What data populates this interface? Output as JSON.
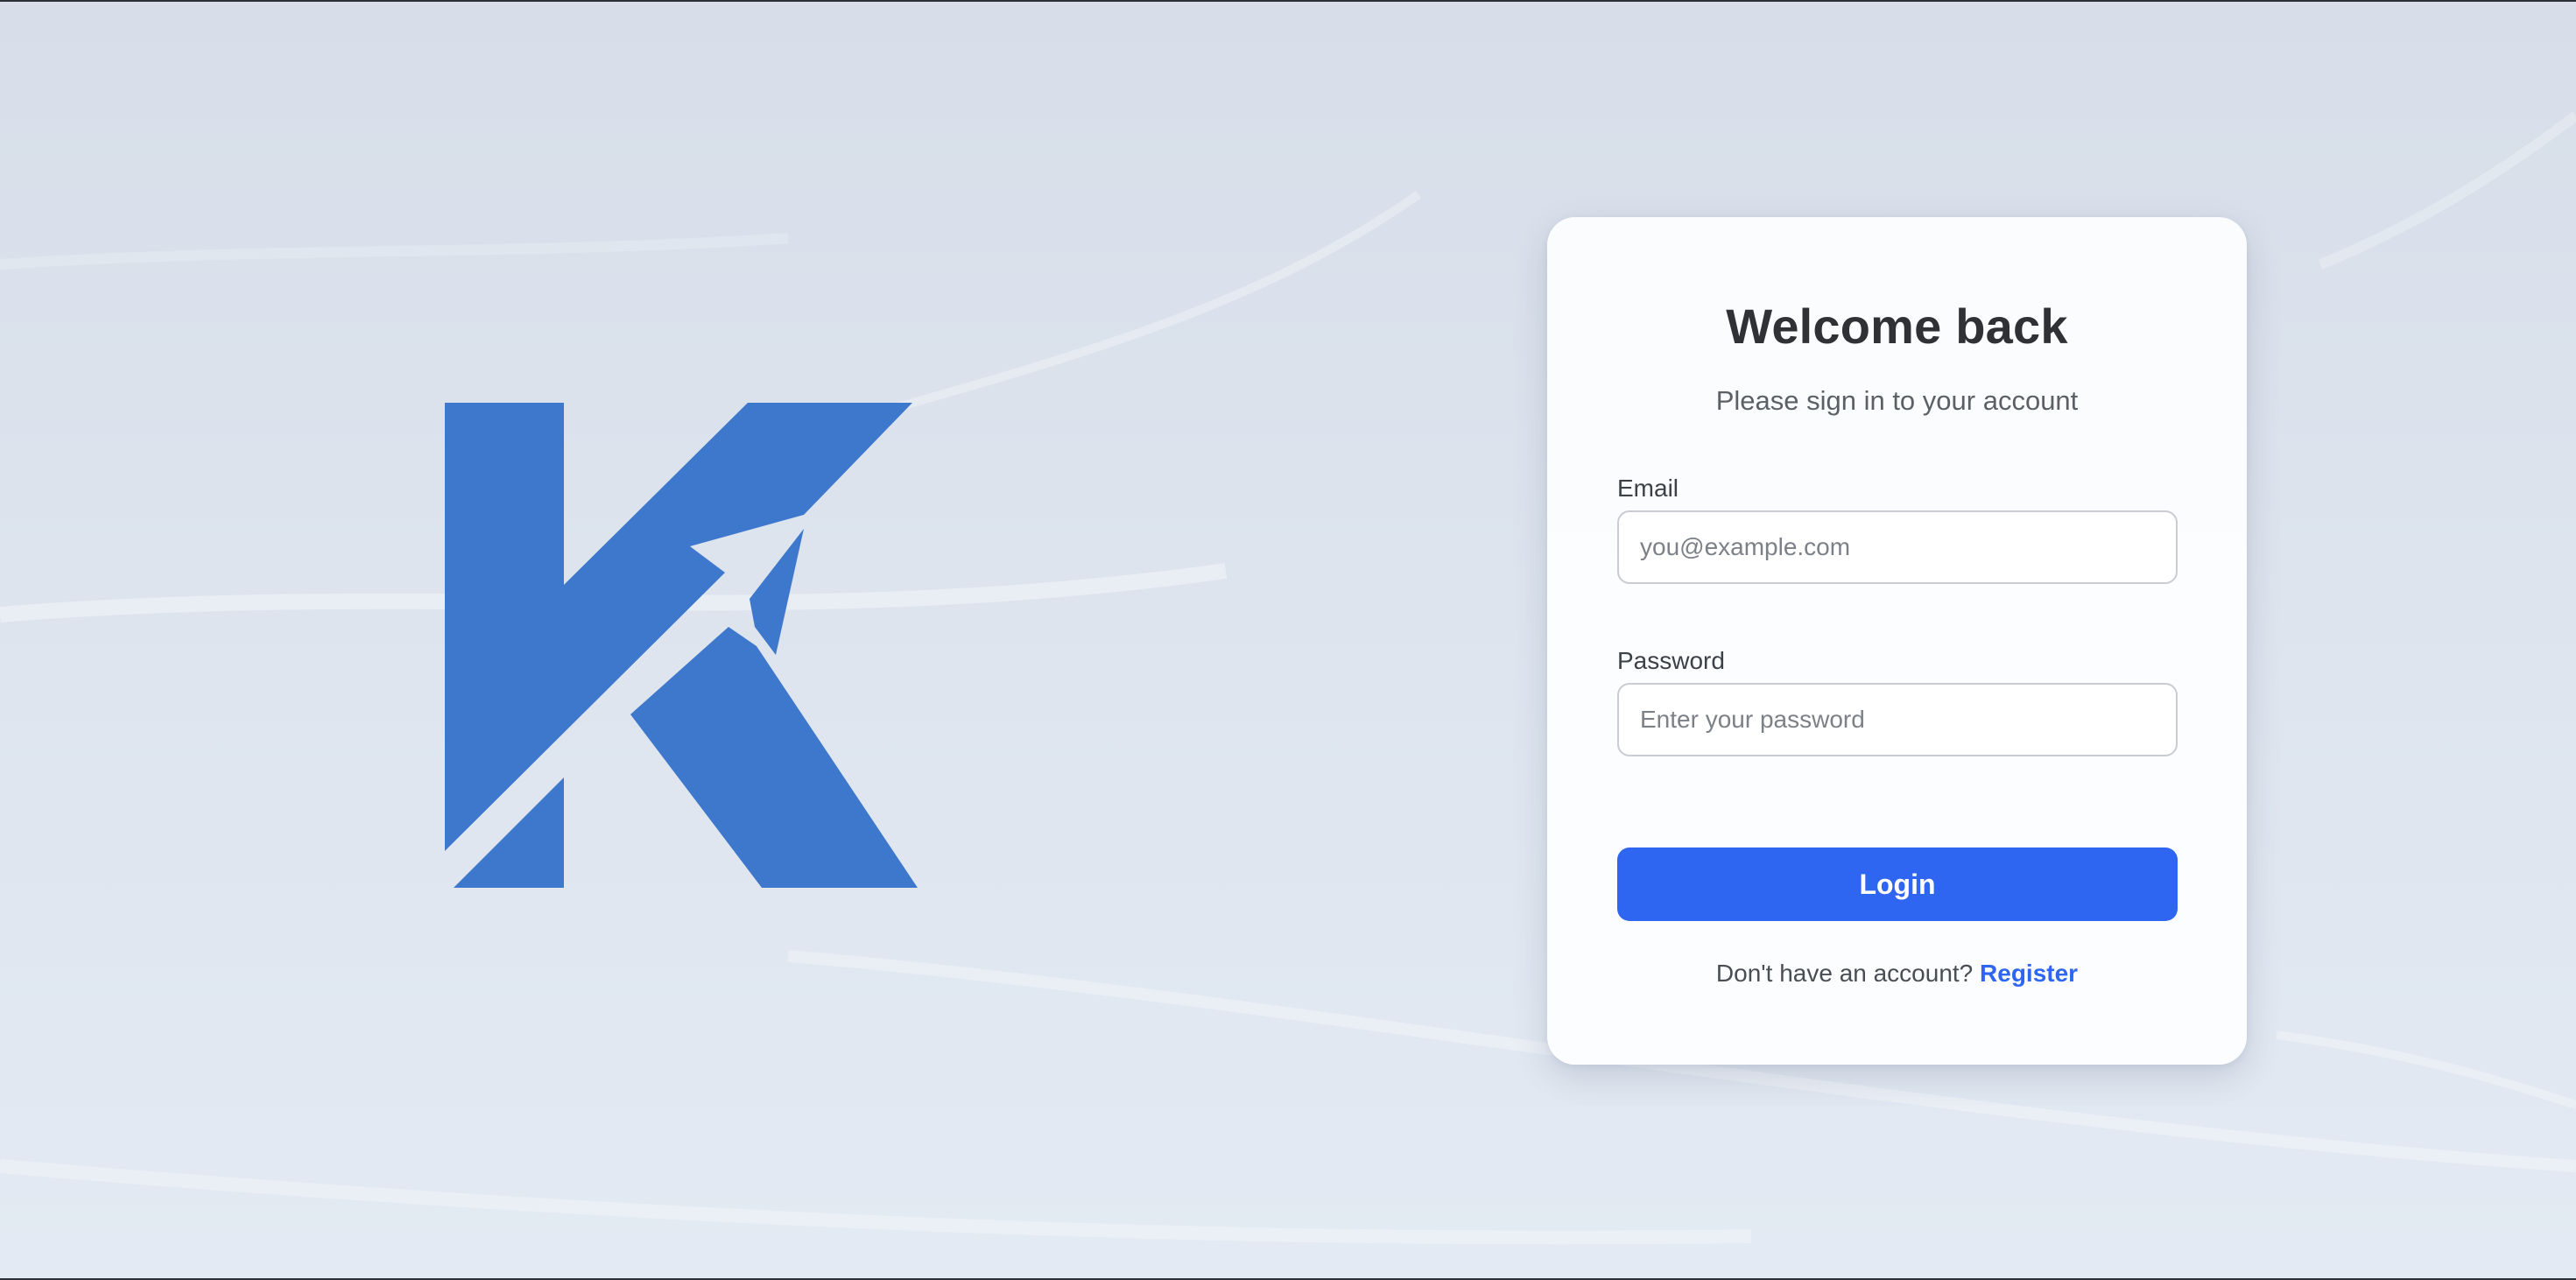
{
  "colors": {
    "logo": "#3d78cc",
    "accent": "#2f66f1",
    "background": "#dde4ee",
    "card": "#fcfdfe",
    "title": "#2f3135"
  },
  "login_card": {
    "title": "Welcome back",
    "subtitle": "Please sign in to your account",
    "email": {
      "label": "Email",
      "placeholder": "you@example.com",
      "value": ""
    },
    "password": {
      "label": "Password",
      "placeholder": "Enter your password",
      "value": ""
    },
    "login_label": "Login",
    "register_prompt": "Don't have an account?",
    "register_label": "Register"
  },
  "logo": {
    "icon": "k-paper-plane-logo"
  }
}
